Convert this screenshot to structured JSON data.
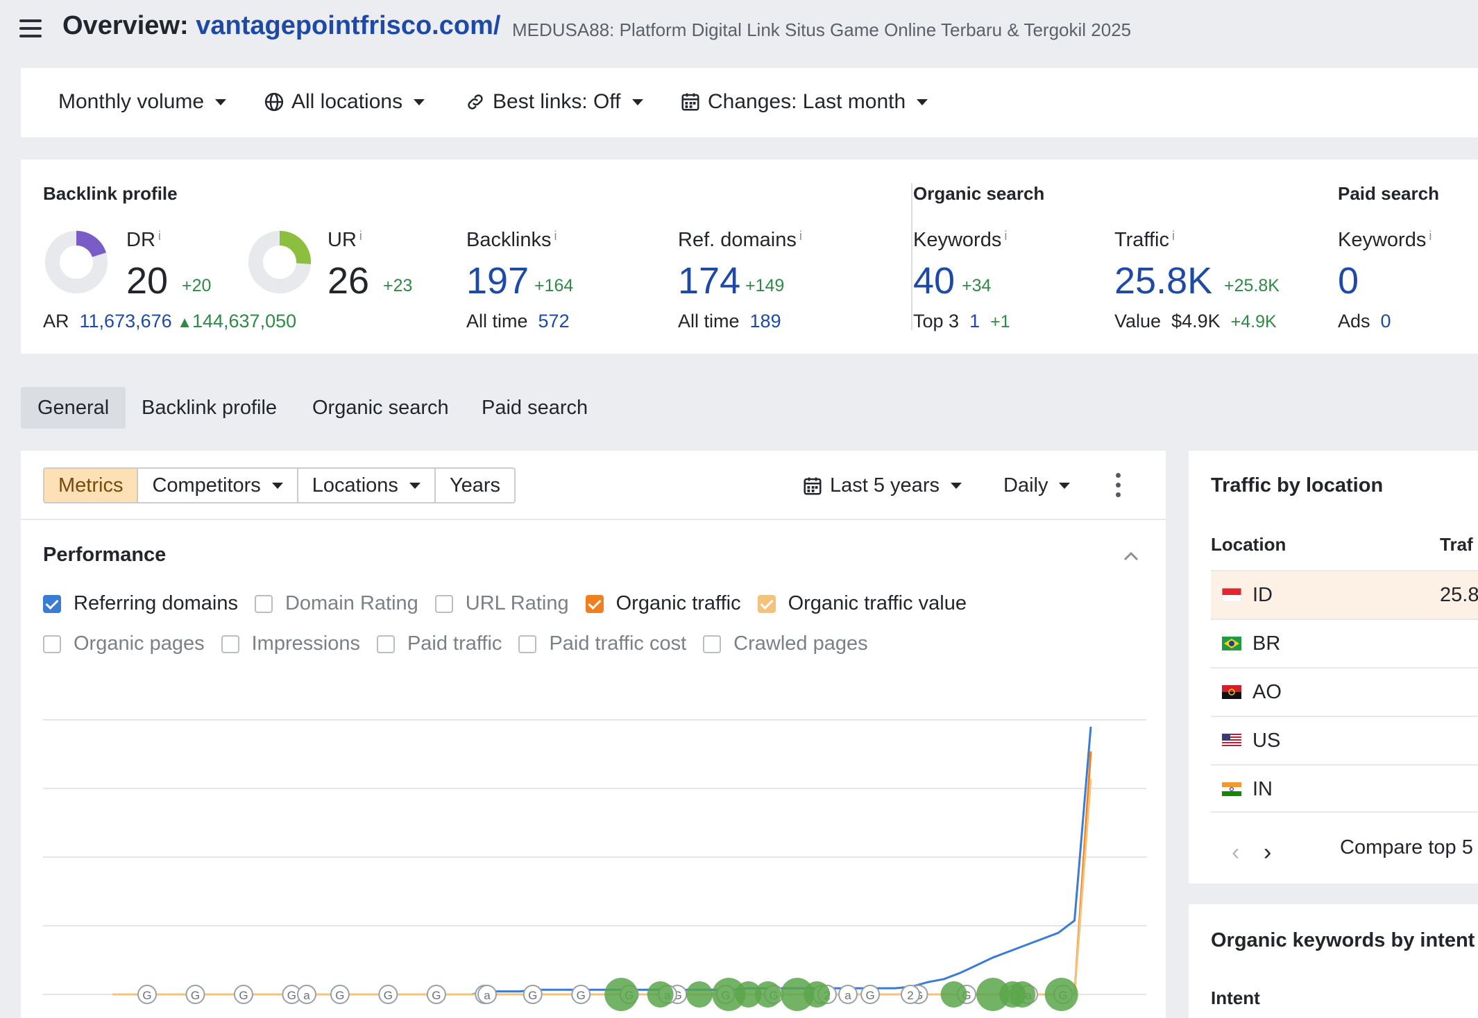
{
  "header": {
    "title_prefix": "Overview: ",
    "domain": "vantagepointfrisco.com/",
    "subtitle": "MEDUSA88: Platform Digital Link Situs Game Online Terbaru & Tergokil 2025"
  },
  "filters": {
    "volume": "Monthly volume",
    "locations": "All locations",
    "best_links": "Best links: Off",
    "changes": "Changes: Last month"
  },
  "backlink_profile": {
    "heading": "Backlink profile",
    "dr": {
      "label": "DR",
      "value": "20",
      "delta": "+20",
      "fraction": 0.2
    },
    "ur": {
      "label": "UR",
      "value": "26",
      "delta": "+23",
      "fraction": 0.26
    },
    "ar": {
      "label": "AR",
      "value": "11,673,676",
      "delta": "144,637,050"
    },
    "backlinks": {
      "label": "Backlinks",
      "value": "197",
      "delta": "+164",
      "alltime_label": "All time",
      "alltime_value": "572"
    },
    "ref_domains": {
      "label": "Ref. domains",
      "value": "174",
      "delta": "+149",
      "alltime_label": "All time",
      "alltime_value": "189"
    }
  },
  "organic_search": {
    "heading": "Organic search",
    "keywords": {
      "label": "Keywords",
      "value": "40",
      "delta": "+34",
      "top3_label": "Top 3",
      "top3_value": "1",
      "top3_delta": "+1"
    },
    "traffic": {
      "label": "Traffic",
      "value": "25.8K",
      "delta": "+25.8K",
      "value_label": "Value",
      "value_amount": "$4.9K",
      "value_delta": "+4.9K"
    }
  },
  "paid_search": {
    "heading": "Paid search",
    "keywords": {
      "label": "Keywords",
      "value": "0",
      "ads_label": "Ads",
      "ads_value": "0"
    }
  },
  "tabs": [
    {
      "label": "General",
      "active": true
    },
    {
      "label": "Backlink profile",
      "active": false
    },
    {
      "label": "Organic search",
      "active": false
    },
    {
      "label": "Paid search",
      "active": false
    }
  ],
  "toolbar": {
    "segments": [
      "Metrics",
      "Competitors",
      "Locations",
      "Years"
    ],
    "period": "Last 5 years",
    "granularity": "Daily"
  },
  "performance": {
    "heading": "Performance",
    "row1": [
      {
        "label": "Referring domains",
        "checked": true,
        "color": "#3a7bd5"
      },
      {
        "label": "Domain Rating",
        "checked": false
      },
      {
        "label": "URL Rating",
        "checked": false
      },
      {
        "label": "Organic traffic",
        "checked": true,
        "color": "#f07f1e"
      },
      {
        "label": "Organic traffic value",
        "checked": true,
        "color": "#f5c27a"
      }
    ],
    "row2": [
      {
        "label": "Organic pages",
        "checked": false
      },
      {
        "label": "Impressions",
        "checked": false
      },
      {
        "label": "Paid traffic",
        "checked": false
      },
      {
        "label": "Paid traffic cost",
        "checked": false
      },
      {
        "label": "Crawled pages",
        "checked": false
      }
    ]
  },
  "chart_data": {
    "type": "line",
    "series": [
      {
        "name": "Referring domains",
        "color": "#3a7bd5",
        "values": [
          0,
          0,
          0,
          0,
          0,
          0,
          0,
          0,
          0,
          0,
          0,
          0,
          0,
          0,
          0,
          0,
          0,
          0,
          0,
          0,
          0,
          0,
          0,
          2,
          2,
          2,
          3,
          3,
          3,
          3,
          3,
          3,
          3,
          3,
          3,
          3,
          3,
          3,
          3,
          4,
          4,
          4,
          4,
          4,
          4,
          4,
          4,
          4,
          4,
          5,
          8,
          10,
          14,
          19,
          24,
          28,
          32,
          36,
          40,
          48,
          174
        ]
      },
      {
        "name": "Organic traffic",
        "color": "#f07f1e",
        "values": [
          0,
          0,
          0,
          0,
          0,
          0,
          0,
          0,
          0,
          0,
          0,
          0,
          0,
          0,
          0,
          0,
          0,
          0,
          0,
          0,
          0,
          0,
          0,
          0,
          0,
          0,
          0,
          0,
          0,
          0,
          0,
          0,
          0,
          0,
          0,
          0,
          0,
          0,
          0,
          0,
          0,
          0,
          0,
          0,
          0,
          0,
          0,
          0,
          0,
          0,
          0,
          0,
          0,
          0,
          0,
          0,
          0,
          0,
          0,
          0,
          158
        ]
      },
      {
        "name": "Organic traffic value",
        "color": "#f5c27a",
        "values": [
          0,
          0,
          0,
          0,
          0,
          0,
          0,
          0,
          0,
          0,
          0,
          0,
          0,
          0,
          0,
          0,
          0,
          0,
          0,
          0,
          0,
          0,
          0,
          0,
          0,
          0,
          0,
          0,
          0,
          0,
          0,
          0,
          0,
          0,
          0,
          0,
          0,
          0,
          0,
          0,
          0,
          0,
          0,
          0,
          0,
          0,
          0,
          0,
          0,
          0,
          0,
          0,
          0,
          0,
          0,
          0,
          0,
          0,
          0,
          0,
          140
        ]
      }
    ],
    "grid": true,
    "markers_g": [
      "G",
      "G",
      "G",
      "G",
      "G",
      "G",
      "G",
      "G",
      "G",
      "G",
      "G",
      "G",
      "G",
      "G",
      "G",
      "G",
      "G",
      "G",
      "G",
      "G"
    ],
    "markers_a": [
      "a",
      "a",
      "a",
      "a",
      "a"
    ],
    "markers_2": [
      "2",
      "2"
    ],
    "bubbles": [
      0.52,
      0.56,
      0.6,
      0.63,
      0.65,
      0.67,
      0.7,
      0.72,
      0.86,
      0.9,
      0.92,
      0.93,
      0.97
    ]
  },
  "traffic_by_location": {
    "heading": "Traffic by location",
    "col_location": "Location",
    "col_traffic": "Traf",
    "rows": [
      {
        "code": "ID",
        "traffic": "25.8",
        "highlight": true
      },
      {
        "code": "BR",
        "traffic": ""
      },
      {
        "code": "AO",
        "traffic": ""
      },
      {
        "code": "US",
        "traffic": ""
      },
      {
        "code": "IN",
        "traffic": ""
      }
    ],
    "compare": "Compare top 5"
  },
  "intent": {
    "heading": "Organic keywords by intent",
    "col": "Intent"
  }
}
